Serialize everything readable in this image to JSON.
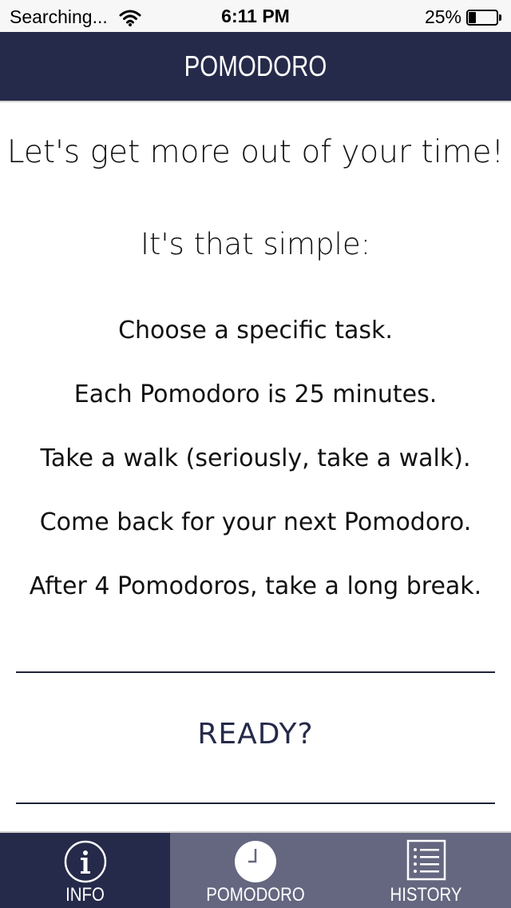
{
  "status_bar": {
    "carrier": "Searching...",
    "time": "6:11 PM",
    "battery_percent": "25%",
    "battery_level": 0.25
  },
  "nav": {
    "title": "POMODORO"
  },
  "intro": {
    "headline": "Let's get more out of your time!",
    "subheadline": "It's that simple:",
    "steps": [
      "Choose a specific task.",
      "Each Pomodoro is 25 minutes.",
      "Take a walk (seriously, take a walk).",
      "Come back for your next Pomodoro.",
      "After 4 Pomodoros, take a long break."
    ]
  },
  "ready": {
    "label": "READY?"
  },
  "tabs": [
    {
      "label": "INFO",
      "icon": "info-icon",
      "selected": true
    },
    {
      "label": "POMODORO",
      "icon": "clock-icon",
      "selected": false
    },
    {
      "label": "HISTORY",
      "icon": "list-icon",
      "selected": false
    }
  ],
  "colors": {
    "nav_background": "#262a4a",
    "tab_selected": "#262a4a",
    "tab_unselected": "#656780",
    "ready_text": "#262a4a"
  }
}
